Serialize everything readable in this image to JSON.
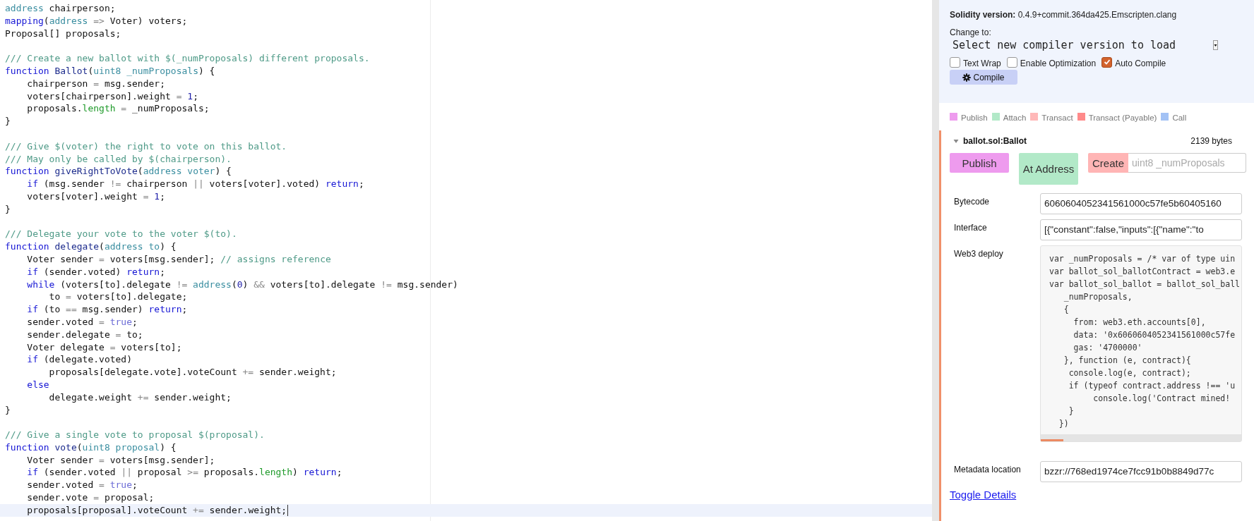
{
  "editor": {
    "lines": [
      {
        "active": false,
        "tokens": [
          {
            "kind": "type",
            "text": "address"
          },
          {
            "kind": "plain",
            "text": " chairperson;"
          }
        ]
      },
      {
        "active": false,
        "tokens": [
          {
            "kind": "keyword",
            "text": "mapping"
          },
          {
            "kind": "plain",
            "text": "("
          },
          {
            "kind": "type",
            "text": "address"
          },
          {
            "kind": "operator",
            "text": " =>"
          },
          {
            "kind": "plain",
            "text": " Voter) voters;"
          }
        ]
      },
      {
        "active": false,
        "tokens": [
          {
            "kind": "plain",
            "text": "Proposal[] proposals;"
          }
        ]
      },
      {
        "active": false
      },
      {
        "active": false,
        "tokens": [
          {
            "kind": "comment",
            "text": "/// Create a new ballot with $(_numProposals) different proposals."
          }
        ]
      },
      {
        "active": false,
        "tokens": [
          {
            "kind": "keyword",
            "text": "function"
          },
          {
            "kind": "def",
            "text": " Ballot"
          },
          {
            "kind": "plain",
            "text": "("
          },
          {
            "kind": "type",
            "text": "uint8"
          },
          {
            "kind": "param",
            "text": " _numProposals"
          },
          {
            "kind": "plain",
            "text": ") {"
          }
        ]
      },
      {
        "active": false,
        "tokens": [
          {
            "kind": "plain",
            "text": "    chairperson "
          },
          {
            "kind": "operator",
            "text": "="
          },
          {
            "kind": "plain",
            "text": " msg.sender;"
          }
        ]
      },
      {
        "active": false,
        "tokens": [
          {
            "kind": "plain",
            "text": "    voters[chairperson].weight "
          },
          {
            "kind": "operator",
            "text": "="
          },
          {
            "kind": "number",
            "text": " 1"
          },
          {
            "kind": "plain",
            "text": ";"
          }
        ]
      },
      {
        "active": false,
        "tokens": [
          {
            "kind": "plain",
            "text": "    proposals."
          },
          {
            "kind": "builtin",
            "text": "length"
          },
          {
            "kind": "operator",
            "text": " ="
          },
          {
            "kind": "plain",
            "text": " _numProposals;"
          }
        ]
      },
      {
        "active": false,
        "tokens": [
          {
            "kind": "plain",
            "text": "}"
          }
        ]
      },
      {
        "active": false
      },
      {
        "active": false,
        "tokens": [
          {
            "kind": "comment",
            "text": "/// Give $(voter) the right to vote on this ballot."
          }
        ]
      },
      {
        "active": false,
        "tokens": [
          {
            "kind": "comment",
            "text": "/// May only be called by $(chairperson)."
          }
        ]
      },
      {
        "active": false,
        "tokens": [
          {
            "kind": "keyword",
            "text": "function"
          },
          {
            "kind": "def",
            "text": " giveRightToVote"
          },
          {
            "kind": "plain",
            "text": "("
          },
          {
            "kind": "type",
            "text": "address"
          },
          {
            "kind": "param",
            "text": " voter"
          },
          {
            "kind": "plain",
            "text": ") {"
          }
        ]
      },
      {
        "active": false,
        "tokens": [
          {
            "kind": "keyword",
            "text": "    if"
          },
          {
            "kind": "plain",
            "text": " (msg.sender "
          },
          {
            "kind": "operator",
            "text": "!="
          },
          {
            "kind": "plain",
            "text": " chairperson "
          },
          {
            "kind": "operator",
            "text": "||"
          },
          {
            "kind": "plain",
            "text": " voters[voter].voted) "
          },
          {
            "kind": "keyword",
            "text": "return"
          },
          {
            "kind": "plain",
            "text": ";"
          }
        ]
      },
      {
        "active": false,
        "tokens": [
          {
            "kind": "plain",
            "text": "    voters[voter].weight "
          },
          {
            "kind": "operator",
            "text": "="
          },
          {
            "kind": "number",
            "text": " 1"
          },
          {
            "kind": "plain",
            "text": ";"
          }
        ]
      },
      {
        "active": false,
        "tokens": [
          {
            "kind": "plain",
            "text": "}"
          }
        ]
      },
      {
        "active": false
      },
      {
        "active": false,
        "tokens": [
          {
            "kind": "comment",
            "text": "/// Delegate your vote to the voter $(to)."
          }
        ]
      },
      {
        "active": false,
        "tokens": [
          {
            "kind": "keyword",
            "text": "function"
          },
          {
            "kind": "def",
            "text": " delegate"
          },
          {
            "kind": "plain",
            "text": "("
          },
          {
            "kind": "type",
            "text": "address"
          },
          {
            "kind": "param",
            "text": " to"
          },
          {
            "kind": "plain",
            "text": ") {"
          }
        ]
      },
      {
        "active": false,
        "tokens": [
          {
            "kind": "plain",
            "text": "    Voter sender "
          },
          {
            "kind": "operator",
            "text": "="
          },
          {
            "kind": "plain",
            "text": " voters[msg.sender]; "
          },
          {
            "kind": "comment",
            "text": "// assigns reference"
          }
        ]
      },
      {
        "active": false,
        "tokens": [
          {
            "kind": "keyword",
            "text": "    if"
          },
          {
            "kind": "plain",
            "text": " (sender.voted) "
          },
          {
            "kind": "keyword",
            "text": "return"
          },
          {
            "kind": "plain",
            "text": ";"
          }
        ]
      },
      {
        "active": false,
        "tokens": [
          {
            "kind": "keyword",
            "text": "    while"
          },
          {
            "kind": "plain",
            "text": " (voters[to].delegate "
          },
          {
            "kind": "operator",
            "text": "!="
          },
          {
            "kind": "type",
            "text": " address"
          },
          {
            "kind": "plain",
            "text": "("
          },
          {
            "kind": "number",
            "text": "0"
          },
          {
            "kind": "plain",
            "text": ") "
          },
          {
            "kind": "operator",
            "text": "&&"
          },
          {
            "kind": "plain",
            "text": " voters[to].delegate "
          },
          {
            "kind": "operator",
            "text": "!="
          },
          {
            "kind": "plain",
            "text": " msg.sender)"
          }
        ]
      },
      {
        "active": false,
        "tokens": [
          {
            "kind": "plain",
            "text": "        to "
          },
          {
            "kind": "operator",
            "text": "="
          },
          {
            "kind": "plain",
            "text": " voters[to].delegate;"
          }
        ]
      },
      {
        "active": false,
        "tokens": [
          {
            "kind": "keyword",
            "text": "    if"
          },
          {
            "kind": "plain",
            "text": " (to "
          },
          {
            "kind": "operator",
            "text": "=="
          },
          {
            "kind": "plain",
            "text": " msg.sender) "
          },
          {
            "kind": "keyword",
            "text": "return"
          },
          {
            "kind": "plain",
            "text": ";"
          }
        ]
      },
      {
        "active": false,
        "tokens": [
          {
            "kind": "plain",
            "text": "    sender.voted "
          },
          {
            "kind": "operator",
            "text": "="
          },
          {
            "kind": "atom",
            "text": " true"
          },
          {
            "kind": "plain",
            "text": ";"
          }
        ]
      },
      {
        "active": false,
        "tokens": [
          {
            "kind": "plain",
            "text": "    sender.delegate "
          },
          {
            "kind": "operator",
            "text": "="
          },
          {
            "kind": "plain",
            "text": " to;"
          }
        ]
      },
      {
        "active": false,
        "tokens": [
          {
            "kind": "plain",
            "text": "    Voter delegate "
          },
          {
            "kind": "operator",
            "text": "="
          },
          {
            "kind": "plain",
            "text": " voters[to];"
          }
        ]
      },
      {
        "active": false,
        "tokens": [
          {
            "kind": "keyword",
            "text": "    if"
          },
          {
            "kind": "plain",
            "text": " (delegate.voted)"
          }
        ]
      },
      {
        "active": false,
        "tokens": [
          {
            "kind": "plain",
            "text": "        proposals[delegate.vote].voteCount "
          },
          {
            "kind": "operator",
            "text": "+="
          },
          {
            "kind": "plain",
            "text": " sender.weight;"
          }
        ]
      },
      {
        "active": false,
        "tokens": [
          {
            "kind": "keyword",
            "text": "    else"
          }
        ]
      },
      {
        "active": false,
        "tokens": [
          {
            "kind": "plain",
            "text": "        delegate.weight "
          },
          {
            "kind": "operator",
            "text": "+="
          },
          {
            "kind": "plain",
            "text": " sender.weight;"
          }
        ]
      },
      {
        "active": false,
        "tokens": [
          {
            "kind": "plain",
            "text": "}"
          }
        ]
      },
      {
        "active": false
      },
      {
        "active": false,
        "tokens": [
          {
            "kind": "comment",
            "text": "/// Give a single vote to proposal $(proposal)."
          }
        ]
      },
      {
        "active": false,
        "tokens": [
          {
            "kind": "keyword",
            "text": "function"
          },
          {
            "kind": "def",
            "text": " vote"
          },
          {
            "kind": "plain",
            "text": "("
          },
          {
            "kind": "type",
            "text": "uint8"
          },
          {
            "kind": "param",
            "text": " proposal"
          },
          {
            "kind": "plain",
            "text": ") {"
          }
        ]
      },
      {
        "active": false,
        "tokens": [
          {
            "kind": "plain",
            "text": "    Voter sender "
          },
          {
            "kind": "operator",
            "text": "="
          },
          {
            "kind": "plain",
            "text": " voters[msg.sender];"
          }
        ]
      },
      {
        "active": false,
        "tokens": [
          {
            "kind": "keyword",
            "text": "    if"
          },
          {
            "kind": "plain",
            "text": " (sender.voted "
          },
          {
            "kind": "operator",
            "text": "||"
          },
          {
            "kind": "plain",
            "text": " proposal "
          },
          {
            "kind": "operator",
            "text": ">="
          },
          {
            "kind": "plain",
            "text": " proposals."
          },
          {
            "kind": "builtin",
            "text": "length"
          },
          {
            "kind": "plain",
            "text": ") "
          },
          {
            "kind": "keyword",
            "text": "return"
          },
          {
            "kind": "plain",
            "text": ";"
          }
        ]
      },
      {
        "active": false,
        "tokens": [
          {
            "kind": "plain",
            "text": "    sender.voted "
          },
          {
            "kind": "operator",
            "text": "="
          },
          {
            "kind": "atom",
            "text": " true"
          },
          {
            "kind": "plain",
            "text": ";"
          }
        ]
      },
      {
        "active": false,
        "tokens": [
          {
            "kind": "plain",
            "text": "    sender.vote "
          },
          {
            "kind": "operator",
            "text": "="
          },
          {
            "kind": "plain",
            "text": " proposal;"
          }
        ]
      },
      {
        "active": true,
        "tokens": [
          {
            "kind": "plain",
            "text": "    proposals[proposal].voteCount "
          },
          {
            "kind": "operator",
            "text": "+="
          },
          {
            "kind": "plain",
            "text": " sender.weight;"
          }
        ]
      }
    ]
  },
  "compiler": {
    "version": "**Solidity version:** 0.4.9+commit.364da425.Emscripten.clang",
    "change_label": "Change to:",
    "select": {
      "value": "Select new compiler version to load"
    },
    "options": [
      {
        "label": "Text Wrap",
        "checked": false
      },
      {
        "label": "Enable Optimization",
        "checked": false
      },
      {
        "label": "Auto Compile",
        "checked": true
      }
    ],
    "compile_button": "Compile"
  },
  "legend": [
    {
      "label": "Publish",
      "color": "#ee9bee"
    },
    {
      "label": "Attach",
      "color": "#b2e9c8"
    },
    {
      "label": "Transact",
      "color": "#ffb8b8"
    },
    {
      "label": "Transact (Payable)",
      "color": "#ff8a8a"
    },
    {
      "label": "Call",
      "color": "#a3c2f5"
    }
  ],
  "contract": {
    "name": "ballot.sol:Ballot",
    "expanded": true,
    "size": "2139 bytes",
    "buttons": [
      {
        "kind": "button",
        "label": "Publish",
        "color": "#ee9bee"
      },
      {
        "kind": "button",
        "label": "At Address",
        "color": "#b2e9c8"
      },
      {
        "kind": "button_with_input",
        "label": "Create",
        "color": "#ffb5b5",
        "placeholder": "uint8 _numProposals"
      }
    ],
    "details": [
      {
        "kind": "field",
        "label": "Bytecode",
        "value": "6060604052341561000c57fe5b60405160"
      },
      {
        "kind": "field",
        "label": "Interface",
        "value": "[{\"constant\":false,\"inputs\":[{\"name\":\"to"
      },
      {
        "kind": "code",
        "label": "Web3 deploy",
        "lines": [
          "var _numProposals = /* var of type uin",
          "var ballot_sol_ballotContract = web3.e",
          "var ballot_sol_ballot = ballot_sol_ball",
          "   _numProposals,",
          "   {",
          "     from: web3.eth.accounts[0],",
          "     data: '0x6060604052341561000c57fe",
          "     gas: '4700000'",
          "   }, function (e, contract){",
          "    console.log(e, contract);",
          "    if (typeof contract.address !== 'u",
          "         console.log('Contract mined! ",
          "    }",
          "  })"
        ]
      },
      {
        "kind": "field",
        "label": "Metadata location",
        "value": "bzzr://768ed1974ce7fcc91b0b8849d77c"
      }
    ],
    "toggle_link": "Toggle Details"
  }
}
